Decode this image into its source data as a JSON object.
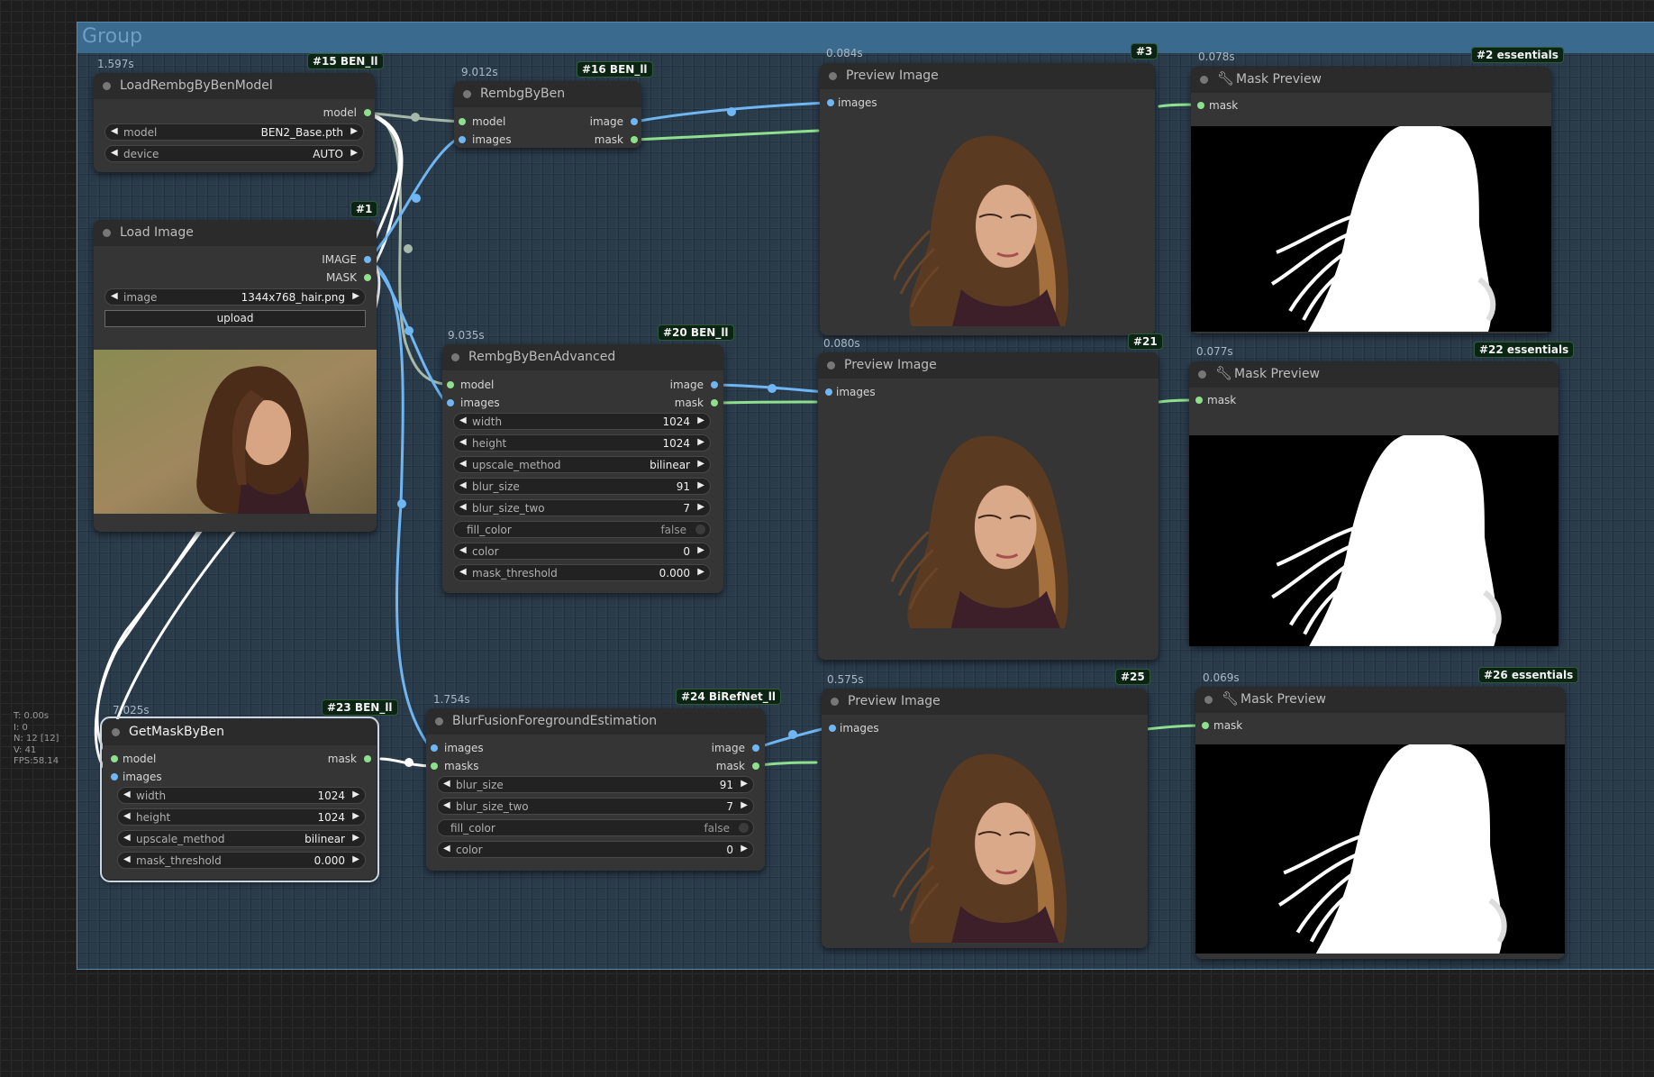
{
  "group": {
    "title": "Group"
  },
  "stats": [
    "T: 0.00s",
    "I: 0",
    "N: 12 [12]",
    "V: 41",
    "FPS:58.14"
  ],
  "nodes": {
    "load_model": {
      "time": "1.597s",
      "badge": "#15 BEN_ll",
      "title": "LoadRembgByBenModel",
      "outputs": [
        "model"
      ],
      "widgets": [
        {
          "name": "model",
          "value": "BEN2_Base.pth"
        },
        {
          "name": "device",
          "value": "AUTO"
        }
      ]
    },
    "load_image": {
      "badge": "#1",
      "title": "Load Image",
      "outputs": [
        "IMAGE",
        "MASK"
      ],
      "widgets": [
        {
          "name": "image",
          "value": "1344x768_hair.png"
        }
      ],
      "button": "upload"
    },
    "rembg": {
      "time": "9.012s",
      "badge": "#16 BEN_ll",
      "title": "RembgByBen",
      "inputs": [
        "model",
        "images"
      ],
      "outputs": [
        "image",
        "mask"
      ]
    },
    "rembg_adv": {
      "time": "9.035s",
      "badge": "#20 BEN_ll",
      "title": "RembgByBenAdvanced",
      "inputs": [
        "model",
        "images"
      ],
      "outputs": [
        "image",
        "mask"
      ],
      "widgets": [
        {
          "name": "width",
          "value": "1024"
        },
        {
          "name": "height",
          "value": "1024"
        },
        {
          "name": "upscale_method",
          "value": "bilinear"
        },
        {
          "name": "blur_size",
          "value": "91"
        },
        {
          "name": "blur_size_two",
          "value": "7"
        },
        {
          "name": "fill_color",
          "value": "false"
        },
        {
          "name": "color",
          "value": "0"
        },
        {
          "name": "mask_threshold",
          "value": "0.000"
        }
      ]
    },
    "get_mask": {
      "time": "7.025s",
      "badge": "#23 BEN_ll",
      "title": "GetMaskByBen",
      "inputs": [
        "model",
        "images"
      ],
      "outputs": [
        "mask"
      ],
      "widgets": [
        {
          "name": "width",
          "value": "1024"
        },
        {
          "name": "height",
          "value": "1024"
        },
        {
          "name": "upscale_method",
          "value": "bilinear"
        },
        {
          "name": "mask_threshold",
          "value": "0.000"
        }
      ]
    },
    "blur_fusion": {
      "time": "1.754s",
      "badge": "#24 BiRefNet_ll",
      "title": "BlurFusionForegroundEstimation",
      "inputs": [
        "images",
        "masks"
      ],
      "outputs": [
        "image",
        "mask"
      ],
      "widgets": [
        {
          "name": "blur_size",
          "value": "91"
        },
        {
          "name": "blur_size_two",
          "value": "7"
        },
        {
          "name": "fill_color",
          "value": "false"
        },
        {
          "name": "color",
          "value": "0"
        }
      ]
    },
    "preview_1": {
      "time": "0.084s",
      "badge": "#3",
      "title": "Preview Image",
      "inputs": [
        "images"
      ]
    },
    "preview_2": {
      "time": "0.080s",
      "badge": "#21",
      "title": "Preview Image",
      "inputs": [
        "images"
      ]
    },
    "preview_3": {
      "time": "0.575s",
      "badge": "#25",
      "title": "Preview Image",
      "inputs": [
        "images"
      ]
    },
    "mask_1": {
      "time": "0.078s",
      "badge": "#2 essentials",
      "title": "Mask Preview",
      "inputs": [
        "mask"
      ]
    },
    "mask_2": {
      "time": "0.077s",
      "badge": "#22 essentials",
      "title": "Mask Preview",
      "inputs": [
        "mask"
      ]
    },
    "mask_3": {
      "time": "0.069s",
      "badge": "#26 essentials",
      "title": "Mask Preview",
      "inputs": [
        "mask"
      ]
    }
  },
  "colors": {
    "image_link": "#6fb6f2",
    "mask_link": "#8ee08e",
    "model_link": "#a6b8a8",
    "selected_link": "#ffffff",
    "group_header": "#3a6a8e"
  }
}
